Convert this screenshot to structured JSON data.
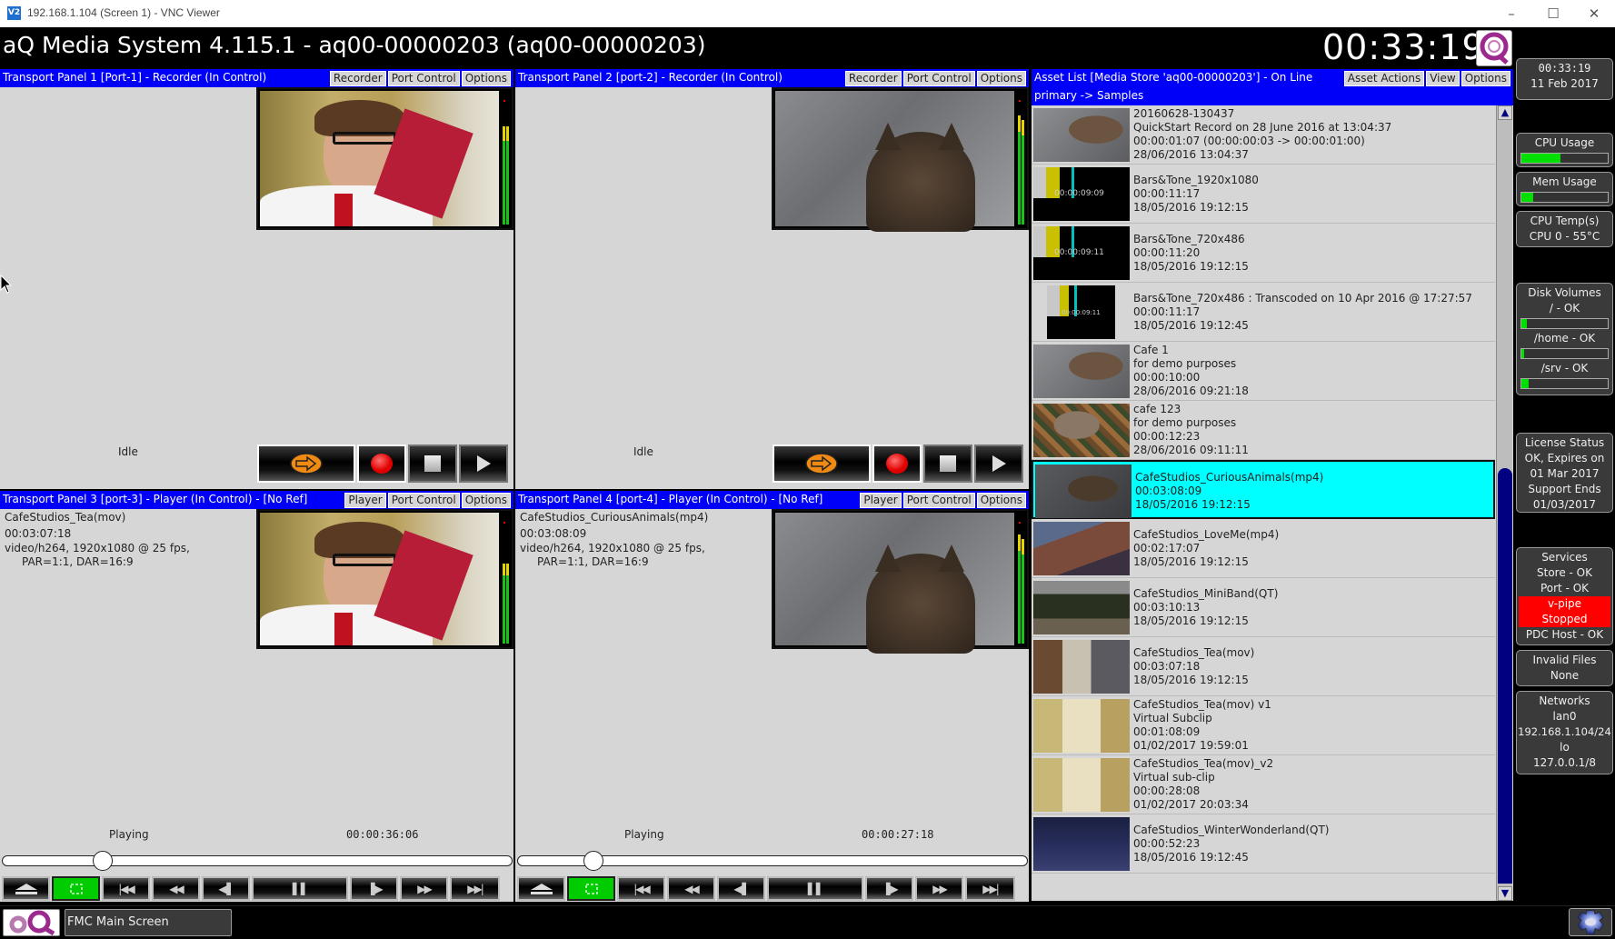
{
  "window": {
    "title": "192.168.1.104 (Screen 1) - VNC Viewer",
    "icon": "vnc-viewer-icon",
    "controls": {
      "minimize": "–",
      "maximize": "☐",
      "close": "✕"
    }
  },
  "app": {
    "title": "aQ Media System 4.115.1 - aq00-00000203 (aq00-00000203)",
    "clock": "00:33:19",
    "logo": "aq-logo-icon"
  },
  "panels": [
    {
      "title": "Transport Panel 1 [Port-1] - Recorder (In Control)",
      "buttons": [
        "Recorder",
        "Port Control",
        "Options"
      ],
      "status": "Idle",
      "thumbnail": "young man in glasses holding red box",
      "controls": [
        "goto-icon",
        "record-icon",
        "stop-icon",
        "play-icon"
      ]
    },
    {
      "title": "Transport Panel 2 [port-2] - Recorder (In Control)",
      "buttons": [
        "Recorder",
        "Port Control",
        "Options"
      ],
      "status": "Idle",
      "thumbnail": "back of tabby cat's head on pavement",
      "controls": [
        "goto-icon",
        "record-icon",
        "stop-icon",
        "play-icon"
      ]
    },
    {
      "title": "Transport Panel 3 [port-3] - Player (In Control) - [No Ref]",
      "buttons": [
        "Player",
        "Port Control",
        "Options"
      ],
      "clip_name": "CafeStudios_Tea(mov)",
      "duration": "00:03:07:18",
      "format_line1": "video/h264, 1920x1080 @ 25 fps,",
      "format_line2": "PAR=1:1, DAR=16:9",
      "status": "Playing",
      "timecode": "00:00:36:06",
      "progress_percent": 19.6,
      "thumbnail": "young man in glasses holding red box",
      "controls": [
        "eject",
        "loop",
        "go-to-start",
        "rewind",
        "step-back",
        "pause",
        "step-forward",
        "fast-forward",
        "go-to-end"
      ]
    },
    {
      "title": "Transport Panel 4 [port-4] - Player (In Control) - [No Ref]",
      "buttons": [
        "Player",
        "Port Control",
        "Options"
      ],
      "clip_name": "CafeStudios_CuriousAnimals(mp4)",
      "duration": "00:03:08:09",
      "format_line1": "video/h264, 1920x1080 @ 25 fps,",
      "format_line2": "PAR=1:1, DAR=16:9",
      "status": "Playing",
      "timecode": "00:00:27:18",
      "progress_percent": 14.7,
      "thumbnail": "back of tabby cat's head on pavement",
      "controls": [
        "eject",
        "loop",
        "go-to-start",
        "rewind",
        "step-back",
        "pause",
        "step-forward",
        "fast-forward",
        "go-to-end"
      ]
    }
  ],
  "asset_list": {
    "title": "Asset List [Media Store 'aq00-00000203'] - On Line",
    "path": "primary -> Samples",
    "buttons": [
      "Asset Actions",
      "View",
      "Options"
    ],
    "items": [
      {
        "lines": [
          "20160628-130437",
          "QuickStart Record on 28 June 2016 at 13:04:37",
          "00:00:01:07 (00:00:00:03 -> 00:00:01:00)",
          "28/06/2016 13:04:37"
        ],
        "thumb": "cat",
        "selected": false
      },
      {
        "lines": [
          "Bars&Tone_1920x1080",
          "00:00:11:17",
          "18/05/2016 19:12:15"
        ],
        "thumb": "bars",
        "thumb_tc": "00:00:09:09",
        "selected": false
      },
      {
        "lines": [
          "Bars&Tone_720x486",
          "00:00:11:20",
          "18/05/2016 19:12:15"
        ],
        "thumb": "bars",
        "thumb_tc": "00:00:09:11",
        "selected": false
      },
      {
        "lines": [
          "Bars&Tone_720x486 : Transcoded on 10 Apr 2016 @ 17:27:57",
          "00:00:11:17",
          "18/05/2016 19:12:45"
        ],
        "thumb": "bars-small",
        "thumb_tc": "00:00:09:11",
        "selected": false
      },
      {
        "lines": [
          "Cafe 1",
          "for demo purposes",
          "00:00:10:00",
          "28/06/2016 09:21:18"
        ],
        "thumb": "cat",
        "selected": false
      },
      {
        "lines": [
          "cafe 123",
          "for demo purposes",
          "00:00:12:23",
          "28/06/2016 09:11:11"
        ],
        "thumb": "leaves",
        "selected": false
      },
      {
        "lines": [
          "CafeStudios_CuriousAnimals(mp4)",
          "00:03:08:09",
          "18/05/2016 19:12:15"
        ],
        "thumb": "cat-dark",
        "selected": true
      },
      {
        "lines": [
          "CafeStudios_LoveMe(mp4)",
          "00:02:17:07",
          "18/05/2016 19:12:15"
        ],
        "thumb": "roof",
        "selected": false
      },
      {
        "lines": [
          "CafeStudios_MiniBand(QT)",
          "00:03:10:13",
          "18/05/2016 19:12:15"
        ],
        "thumb": "forest",
        "selected": false
      },
      {
        "lines": [
          "CafeStudios_Tea(mov)",
          "00:03:07:18",
          "18/05/2016 19:12:15"
        ],
        "thumb": "room",
        "selected": false
      },
      {
        "lines": [
          "CafeStudios_Tea(mov) v1",
          "Virtual Subclip",
          "00:01:08:09",
          "01/02/2017 19:59:01"
        ],
        "thumb": "kitchen",
        "selected": false
      },
      {
        "lines": [
          "CafeStudios_Tea(mov)_v2",
          "Virtual sub-clip",
          "00:00:28:08",
          "01/02/2017 20:03:34"
        ],
        "thumb": "kitchen",
        "selected": false
      },
      {
        "lines": [
          "CafeStudios_WinterWonderland(QT)",
          "00:00:52:23",
          "18/05/2016 19:12:45"
        ],
        "thumb": "night",
        "selected": false
      }
    ]
  },
  "sidebar": {
    "clock": {
      "time": "00:33:19",
      "date": "11 Feb 2017"
    },
    "cpu": {
      "label": "CPU Usage",
      "percent": 45
    },
    "mem": {
      "label": "Mem Usage",
      "percent": 14
    },
    "temp": {
      "label": "CPU Temp(s)",
      "value": "CPU 0 - 55°C"
    },
    "disks": {
      "label": "Disk Volumes",
      "volumes": [
        {
          "name": "/ - OK",
          "percent": 6
        },
        {
          "name": "/home - OK",
          "percent": 3
        },
        {
          "name": "/srv - OK",
          "percent": 8
        }
      ]
    },
    "license": {
      "lines": [
        "License Status",
        "OK, Expires on",
        "01 Mar 2017",
        "Support Ends",
        "01/03/2017"
      ]
    },
    "services": {
      "label": "Services",
      "store": "Store - OK",
      "port": "Port - OK",
      "vpipe_1": "v-pipe",
      "vpipe_2": "Stopped",
      "pdc": "PDC Host - OK",
      "alert_color": "#ff0000"
    },
    "invalid_files": {
      "label": "Invalid Files",
      "value": "None"
    },
    "networks": {
      "lines": [
        "Networks",
        "lan0",
        "192.168.1.104/24",
        "lo",
        "127.0.0.1/8"
      ]
    }
  },
  "taskbar": {
    "logo": "aq-logo-icon",
    "window_label": "FMC Main Screen",
    "settings_icon": "gear-icon"
  },
  "colors": {
    "panel_header": "#0000f8",
    "selected_row": "#00ffff",
    "meter_green": "#17c317",
    "loop_green": "#00cc00"
  }
}
